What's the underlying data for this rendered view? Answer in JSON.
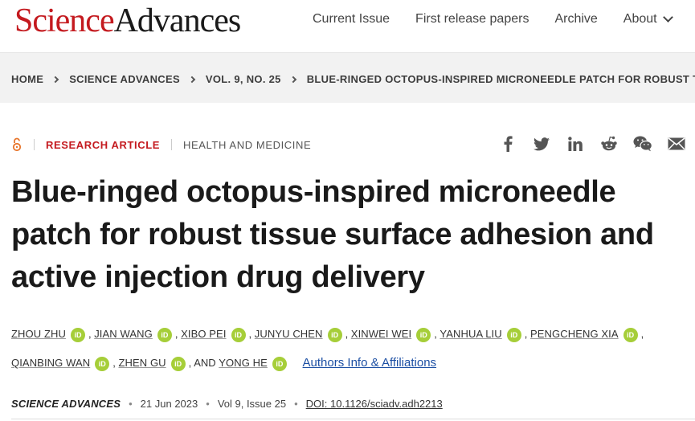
{
  "header": {
    "logo_science": "Science",
    "logo_advances": "Advances",
    "nav": [
      "Current Issue",
      "First release papers",
      "Archive",
      "About"
    ]
  },
  "breadcrumb": [
    "HOME",
    "SCIENCE ADVANCES",
    "VOL. 9, NO. 25",
    "BLUE-RINGED OCTOPUS-INSPIRED MICRONEEDLE PATCH FOR ROBUST TISS..."
  ],
  "article": {
    "type": "RESEARCH ARTICLE",
    "topic": "HEALTH AND MEDICINE",
    "title": "Blue-ringed octopus-inspired microneedle patch for robust tissue surface adhesion and active injection drug delivery",
    "authors": [
      "ZHOU ZHU",
      "JIAN WANG",
      "XIBO PEI",
      "JUNYU CHEN",
      "XINWEI WEI",
      "YANHUA LIU",
      "PENGCHENG XIA",
      "QIANBING WAN",
      "ZHEN GU",
      "YONG HE"
    ],
    "orcid_label": "iD",
    "and_text": "AND",
    "affiliations_link": "Authors Info & Affiliations",
    "journal": "SCIENCE ADVANCES",
    "date": "21 Jun 2023",
    "issue": "Vol 9, Issue 25",
    "doi": "DOI: 10.1126/sciadv.adh2213"
  },
  "share_icons": [
    "facebook-icon",
    "twitter-icon",
    "linkedin-icon",
    "reddit-icon",
    "wechat-icon",
    "email-icon"
  ],
  "colors": {
    "brand_red": "#c41a1f",
    "orcid_green": "#a6ce39",
    "link_blue": "#1c4fa3",
    "oa_orange": "#e8762d"
  }
}
